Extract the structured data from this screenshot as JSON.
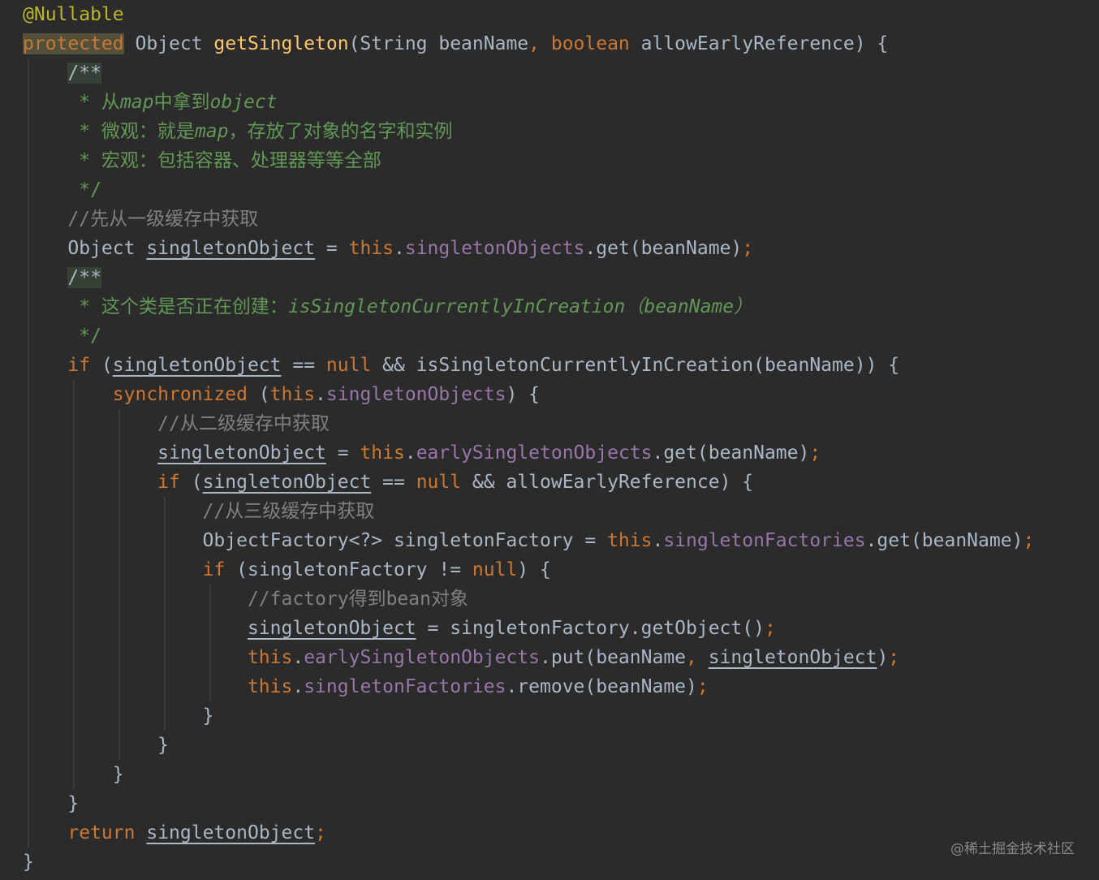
{
  "code": {
    "lines": [
      [
        {
          "t": "@Nullable",
          "s": "ann"
        }
      ],
      [
        {
          "t": "protected",
          "s": "kwhl"
        },
        {
          "t": " Object ",
          "s": "plain"
        },
        {
          "t": "getSingleton",
          "s": "method"
        },
        {
          "t": "(String beanName",
          "s": "plain"
        },
        {
          "t": ", ",
          "s": "kw"
        },
        {
          "t": "boolean",
          "s": "kw"
        },
        {
          "t": " allowEarlyReference) {",
          "s": "plain"
        }
      ],
      [
        {
          "t": "    ",
          "s": "plain"
        },
        {
          "t": "/**",
          "s": "hl"
        }
      ],
      [
        {
          "t": "     * 从",
          "s": "doc"
        },
        {
          "t": "map",
          "s": "docit"
        },
        {
          "t": "中拿到",
          "s": "doc"
        },
        {
          "t": "object",
          "s": "docit"
        }
      ],
      [
        {
          "t": "     * 微观：就是",
          "s": "doc"
        },
        {
          "t": "map",
          "s": "docit"
        },
        {
          "t": "，存放了对象的名字和实例",
          "s": "doc"
        }
      ],
      [
        {
          "t": "     * 宏观：包括容器、处理器等等全部",
          "s": "doc"
        }
      ],
      [
        {
          "t": "     */",
          "s": "doc"
        }
      ],
      [
        {
          "t": "    //先从一级缓存中获取",
          "s": "comment"
        }
      ],
      [
        {
          "t": "    Object ",
          "s": "plain"
        },
        {
          "t": "singletonObject",
          "s": "uvar"
        },
        {
          "t": " = ",
          "s": "plain"
        },
        {
          "t": "this",
          "s": "kw"
        },
        {
          "t": ".",
          "s": "plain"
        },
        {
          "t": "singletonObjects",
          "s": "field"
        },
        {
          "t": ".get(beanName)",
          "s": "plain"
        },
        {
          "t": ";",
          "s": "kw"
        }
      ],
      [
        {
          "t": "    ",
          "s": "plain"
        },
        {
          "t": "/**",
          "s": "hl"
        }
      ],
      [
        {
          "t": "     * 这个类是否正在创建：",
          "s": "doc"
        },
        {
          "t": "isSingletonCurrentlyInCreation（beanName）",
          "s": "docit"
        }
      ],
      [
        {
          "t": "     */",
          "s": "doc"
        }
      ],
      [
        {
          "t": "    ",
          "s": "plain"
        },
        {
          "t": "if",
          "s": "kw"
        },
        {
          "t": " (",
          "s": "plain"
        },
        {
          "t": "singletonObject",
          "s": "uvar"
        },
        {
          "t": " == ",
          "s": "plain"
        },
        {
          "t": "null",
          "s": "kw"
        },
        {
          "t": " && isSingletonCurrentlyInCreation(beanName)) {",
          "s": "plain"
        }
      ],
      [
        {
          "t": "        ",
          "s": "plain"
        },
        {
          "t": "synchronized",
          "s": "kw"
        },
        {
          "t": " (",
          "s": "plain"
        },
        {
          "t": "this",
          "s": "kw"
        },
        {
          "t": ".",
          "s": "plain"
        },
        {
          "t": "singletonObjects",
          "s": "field"
        },
        {
          "t": ") {",
          "s": "plain"
        }
      ],
      [
        {
          "t": "            //从二级缓存中获取",
          "s": "comment"
        }
      ],
      [
        {
          "t": "            ",
          "s": "plain"
        },
        {
          "t": "singletonObject",
          "s": "uvar"
        },
        {
          "t": " = ",
          "s": "plain"
        },
        {
          "t": "this",
          "s": "kw"
        },
        {
          "t": ".",
          "s": "plain"
        },
        {
          "t": "earlySingletonObjects",
          "s": "field"
        },
        {
          "t": ".get(beanName)",
          "s": "plain"
        },
        {
          "t": ";",
          "s": "kw"
        }
      ],
      [
        {
          "t": "            ",
          "s": "plain"
        },
        {
          "t": "if",
          "s": "kw"
        },
        {
          "t": " (",
          "s": "plain"
        },
        {
          "t": "singletonObject",
          "s": "uvar"
        },
        {
          "t": " == ",
          "s": "plain"
        },
        {
          "t": "null",
          "s": "kw"
        },
        {
          "t": " && allowEarlyReference) {",
          "s": "plain"
        }
      ],
      [
        {
          "t": "                //从三级缓存中获取",
          "s": "comment"
        }
      ],
      [
        {
          "t": "                ObjectFactory<?> singletonFactory = ",
          "s": "plain"
        },
        {
          "t": "this",
          "s": "kw"
        },
        {
          "t": ".",
          "s": "plain"
        },
        {
          "t": "singletonFactories",
          "s": "field"
        },
        {
          "t": ".get(beanName)",
          "s": "plain"
        },
        {
          "t": ";",
          "s": "kw"
        }
      ],
      [
        {
          "t": "                ",
          "s": "plain"
        },
        {
          "t": "if",
          "s": "kw"
        },
        {
          "t": " (singletonFactory != ",
          "s": "plain"
        },
        {
          "t": "null",
          "s": "kw"
        },
        {
          "t": ") {",
          "s": "plain"
        }
      ],
      [
        {
          "t": "                    //factory得到bean对象",
          "s": "comment"
        }
      ],
      [
        {
          "t": "                    ",
          "s": "plain"
        },
        {
          "t": "singletonObject",
          "s": "uvar"
        },
        {
          "t": " = singletonFactory.getObject()",
          "s": "plain"
        },
        {
          "t": ";",
          "s": "kw"
        }
      ],
      [
        {
          "t": "                    ",
          "s": "plain"
        },
        {
          "t": "this",
          "s": "kw"
        },
        {
          "t": ".",
          "s": "plain"
        },
        {
          "t": "earlySingletonObjects",
          "s": "field"
        },
        {
          "t": ".put(beanName",
          "s": "plain"
        },
        {
          "t": ", ",
          "s": "kw"
        },
        {
          "t": "singletonObject",
          "s": "uvar"
        },
        {
          "t": ")",
          "s": "plain"
        },
        {
          "t": ";",
          "s": "kw"
        }
      ],
      [
        {
          "t": "                    ",
          "s": "plain"
        },
        {
          "t": "this",
          "s": "kw"
        },
        {
          "t": ".",
          "s": "plain"
        },
        {
          "t": "singletonFactories",
          "s": "field"
        },
        {
          "t": ".remove(beanName)",
          "s": "plain"
        },
        {
          "t": ";",
          "s": "kw"
        }
      ],
      [
        {
          "t": "                }",
          "s": "plain"
        }
      ],
      [
        {
          "t": "            }",
          "s": "plain"
        }
      ],
      [
        {
          "t": "        }",
          "s": "plain"
        }
      ],
      [
        {
          "t": "    }",
          "s": "plain"
        }
      ],
      [
        {
          "t": "    ",
          "s": "plain"
        },
        {
          "t": "return",
          "s": "kw"
        },
        {
          "t": " ",
          "s": "plain"
        },
        {
          "t": "singletonObject",
          "s": "uvar"
        },
        {
          "t": ";",
          "s": "kw"
        }
      ],
      [
        {
          "t": "}",
          "s": "plain"
        }
      ]
    ]
  },
  "watermark": "@稀土掘金技术社区"
}
